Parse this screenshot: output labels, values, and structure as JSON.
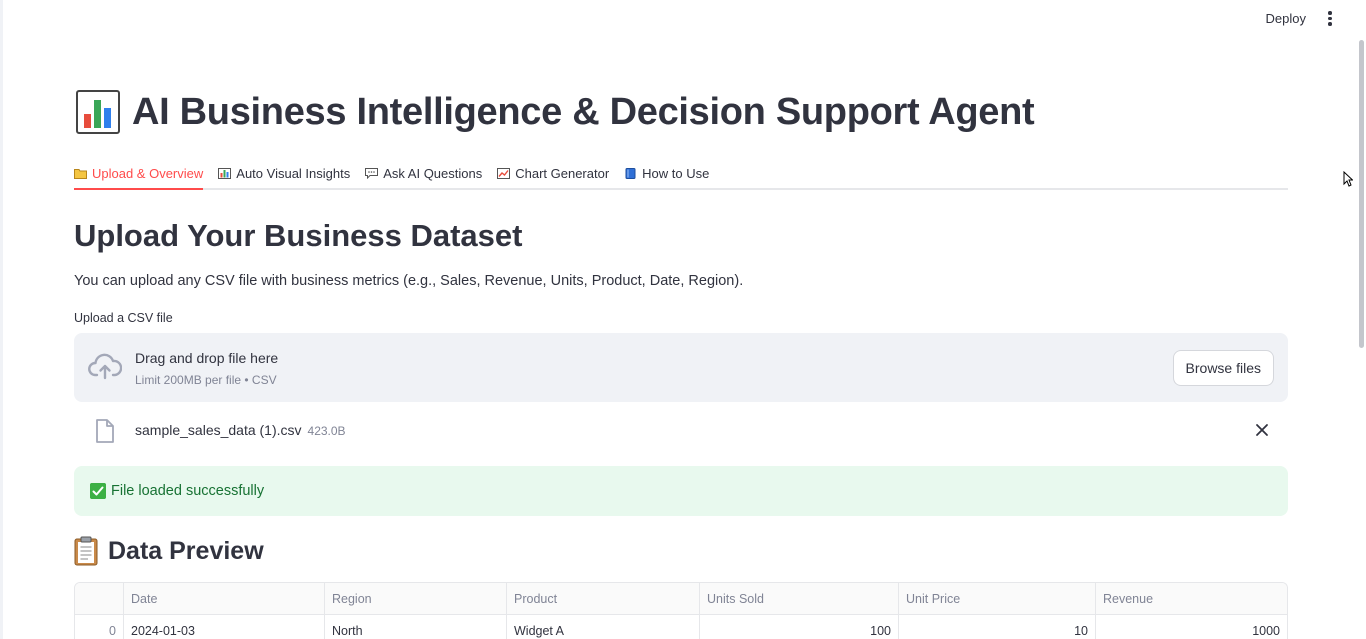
{
  "header": {
    "deploy_label": "Deploy"
  },
  "page": {
    "title": "AI Business Intelligence & Decision Support Agent"
  },
  "tabs": [
    {
      "label": "Upload & Overview",
      "icon": "folder-icon",
      "active": true
    },
    {
      "label": "Auto Visual Insights",
      "icon": "bar-chart-icon"
    },
    {
      "label": "Ask AI Questions",
      "icon": "speech-bubble-icon"
    },
    {
      "label": "Chart Generator",
      "icon": "line-chart-icon"
    },
    {
      "label": "How to Use",
      "icon": "book-icon"
    }
  ],
  "upload": {
    "heading": "Upload Your Business Dataset",
    "description": "You can upload any CSV file with business metrics (e.g., Sales, Revenue, Units, Product, Date, Region).",
    "label": "Upload a CSV file",
    "drop_text": "Drag and drop file here",
    "limit_text": "Limit 200MB per file • CSV",
    "browse_label": "Browse files",
    "file": {
      "name": "sample_sales_data (1).csv",
      "size": "423.0B"
    }
  },
  "status": {
    "message": "File loaded successfully",
    "color": "#177233"
  },
  "preview": {
    "heading": "Data Preview",
    "columns": [
      "",
      "Date",
      "Region",
      "Product",
      "Units Sold",
      "Unit Price",
      "Revenue"
    ],
    "rows": [
      [
        "0",
        "2024-01-03",
        "North",
        "Widget A",
        "100",
        "10",
        "1000"
      ]
    ]
  },
  "colors": {
    "accent": "#ff4b4b",
    "success_bg": "#e8f9ee",
    "text": "#31333f"
  }
}
